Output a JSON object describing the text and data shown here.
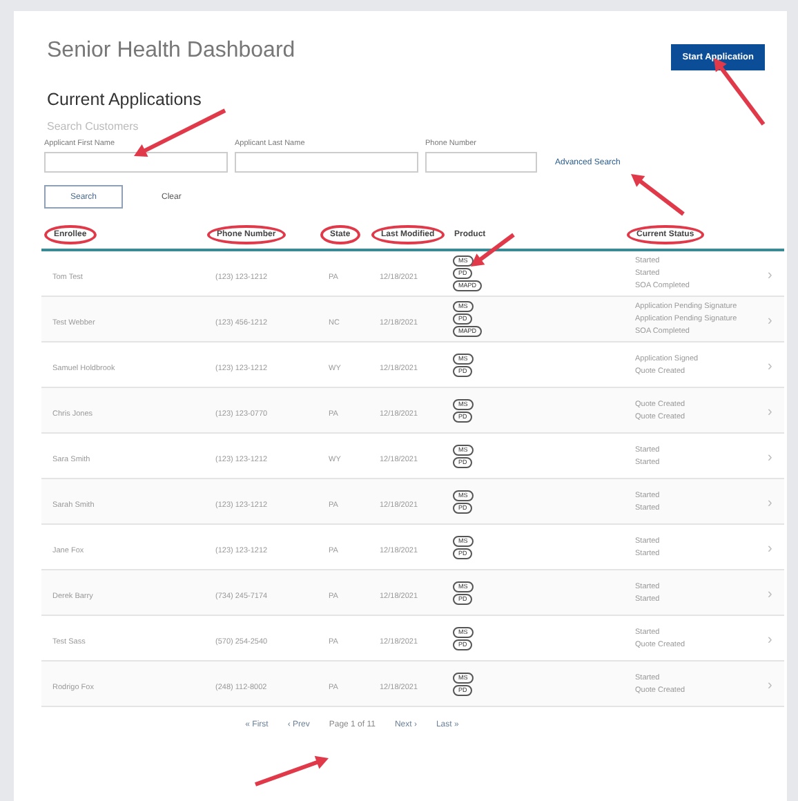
{
  "title": "Senior Health Dashboard",
  "start_button": "Start Application",
  "section_title": "Current Applications",
  "search": {
    "title": "Search Customers",
    "fields": [
      {
        "label": "Applicant First Name"
      },
      {
        "label": "Applicant Last Name"
      },
      {
        "label": "Phone Number"
      }
    ],
    "advanced_link": "Advanced Search",
    "search_button": "Search",
    "clear_link": "Clear"
  },
  "table": {
    "columns": [
      {
        "label": "Enrollee",
        "circled": true
      },
      {
        "label": "Phone Number",
        "circled": true
      },
      {
        "label": "State",
        "circled": true
      },
      {
        "label": "Last Modified",
        "circled": true
      },
      {
        "label": "Product",
        "circled": false
      },
      {
        "label": "Current Status",
        "circled": true
      }
    ],
    "rows": [
      {
        "enrollee": "Tom Test",
        "phone": "(123) 123-1212",
        "state": "PA",
        "modified": "12/18/2021",
        "products": [
          "MS",
          "PD",
          "MAPD"
        ],
        "statuses": [
          "Started",
          "Started",
          "SOA Completed"
        ],
        "chevron": "›"
      },
      {
        "enrollee": "Test Webber",
        "phone": "(123) 456-1212",
        "state": "NC",
        "modified": "12/18/2021",
        "products": [
          "MS",
          "PD",
          "MAPD"
        ],
        "statuses": [
          "Application Pending Signature",
          "Application Pending Signature",
          "SOA Completed"
        ],
        "chevron": "›"
      },
      {
        "enrollee": "Samuel Holdbrook",
        "phone": "(123) 123-1212",
        "state": "WY",
        "modified": "12/18/2021",
        "products": [
          "MS",
          "PD"
        ],
        "statuses": [
          "Application Signed",
          "Quote Created"
        ],
        "chevron": "›"
      },
      {
        "enrollee": "Chris Jones",
        "phone": "(123) 123-0770",
        "state": "PA",
        "modified": "12/18/2021",
        "products": [
          "MS",
          "PD"
        ],
        "statuses": [
          "Quote Created",
          "Quote Created"
        ],
        "chevron": "›"
      },
      {
        "enrollee": "Sara Smith",
        "phone": "(123) 123-1212",
        "state": "WY",
        "modified": "12/18/2021",
        "products": [
          "MS",
          "PD"
        ],
        "statuses": [
          "Started",
          "Started"
        ],
        "chevron": "›"
      },
      {
        "enrollee": "Sarah Smith",
        "phone": "(123) 123-1212",
        "state": "PA",
        "modified": "12/18/2021",
        "products": [
          "MS",
          "PD"
        ],
        "statuses": [
          "Started",
          "Started"
        ],
        "chevron": "›"
      },
      {
        "enrollee": "Jane Fox",
        "phone": "(123) 123-1212",
        "state": "PA",
        "modified": "12/18/2021",
        "products": [
          "MS",
          "PD"
        ],
        "statuses": [
          "Started",
          "Started"
        ],
        "chevron": "›"
      },
      {
        "enrollee": "Derek Barry",
        "phone": "(734) 245-7174",
        "state": "PA",
        "modified": "12/18/2021",
        "products": [
          "MS",
          "PD"
        ],
        "statuses": [
          "Started",
          "Started"
        ],
        "chevron": "›"
      },
      {
        "enrollee": "Test Sass",
        "phone": "(570) 254-2540",
        "state": "PA",
        "modified": "12/18/2021",
        "products": [
          "MS",
          "PD"
        ],
        "statuses": [
          "Started",
          "Quote Created"
        ],
        "chevron": "›"
      },
      {
        "enrollee": "Rodrigo Fox",
        "phone": "(248) 112-8002",
        "state": "PA",
        "modified": "12/18/2021",
        "products": [
          "MS",
          "PD"
        ],
        "statuses": [
          "Started",
          "Quote Created"
        ],
        "chevron": "›"
      }
    ]
  },
  "pagination": [
    {
      "kind": "link",
      "label": "« First"
    },
    {
      "kind": "link",
      "label": "‹ Prev"
    },
    {
      "kind": "text",
      "label": "Page 1 of 11"
    },
    {
      "kind": "link",
      "label": "Next ›"
    },
    {
      "kind": "link",
      "label": "Last »"
    }
  ]
}
